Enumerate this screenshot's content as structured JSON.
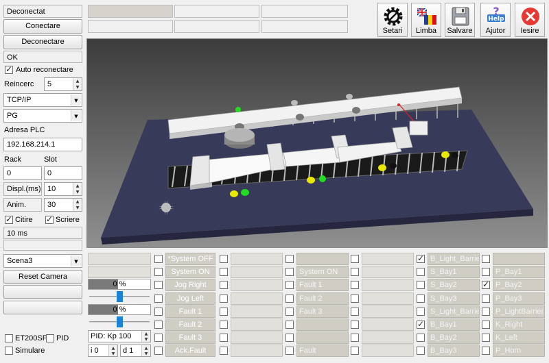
{
  "connection": {
    "status": "Deconectat",
    "connect_label": "Conectare",
    "disconnect_label": "Deconectare",
    "result": "OK",
    "auto_reconnect_label": "Auto reconectare",
    "auto_reconnect_checked": true,
    "retry_label": "Reincerc",
    "retry_value": "5",
    "protocol": "TCP/IP",
    "device_type": "PG",
    "plc_address_label": "Adresa PLC",
    "plc_address": "192.168.214.1",
    "rack_label": "Rack",
    "slot_label": "Slot",
    "rack_value": "0",
    "slot_value": "0",
    "display_label": "Displ.(ms)",
    "display_value": "10",
    "anim_label": "Anim.",
    "anim_value": "30",
    "read_label": "Citire",
    "write_label": "Scriere",
    "read_checked": true,
    "write_checked": true,
    "cycle_time": "10 ms"
  },
  "scene": {
    "selected": "Scena3",
    "reset_camera_label": "Reset Camera"
  },
  "options": {
    "et200sp_label": "ET200SP",
    "pid_label": "PID",
    "simulate_label": "Simulare"
  },
  "toolbar": {
    "settings": "Setari",
    "language": "Limba",
    "save": "Salvare",
    "help": "Ajutor",
    "exit": "Iesire"
  },
  "controls": {
    "slider1_value": "0 %",
    "slider2_value": "0 %",
    "pid_label": "PID: Kp 100",
    "i_value": "i 0",
    "d_value": "d 1",
    "slider1_level": 0.4,
    "slider2_level": 0.4
  },
  "buttons": [
    "*System OFF",
    "System ON",
    "Jog Right",
    "Jog Left",
    "Fault 1",
    "Fault 2",
    "Fault 3",
    "Ack.Fault"
  ],
  "col3": [
    "",
    "System ON",
    "Fault 1",
    "Fault 2",
    "Fault 3",
    "",
    "",
    "Fault"
  ],
  "col4": [
    {
      "label": "B_Light_Barrier",
      "checked": true
    },
    {
      "label": "S_Bay1",
      "checked": false
    },
    {
      "label": "S_Bay2",
      "checked": false
    },
    {
      "label": "S_Bay3",
      "checked": false
    },
    {
      "label": "S_Light_Barrier",
      "checked": false
    },
    {
      "label": "B_Bay1",
      "checked": true
    },
    {
      "label": "B_Bay2",
      "checked": false
    },
    {
      "label": "B_Bay3",
      "checked": false
    }
  ],
  "col5": [
    {
      "label": "",
      "checked": false
    },
    {
      "label": "P_Bay1",
      "checked": false
    },
    {
      "label": "P_Bay2",
      "checked": true
    },
    {
      "label": "P_Bay3",
      "checked": false
    },
    {
      "label": "P_LightBarrier",
      "checked": false
    },
    {
      "label": "K_Right",
      "checked": false
    },
    {
      "label": "K_Left",
      "checked": false
    },
    {
      "label": "P_Horn",
      "checked": false
    }
  ],
  "colors": {
    "viewport_bg_top": "#3d3d3d",
    "viewport_bg_bottom": "#8e8e8e",
    "platform": "#3a3a5e",
    "green_lamp": "#22dd22",
    "yellow_lamp": "#e8e800",
    "slider_handle": "#1b82d6",
    "exit_red": "#e53935"
  }
}
